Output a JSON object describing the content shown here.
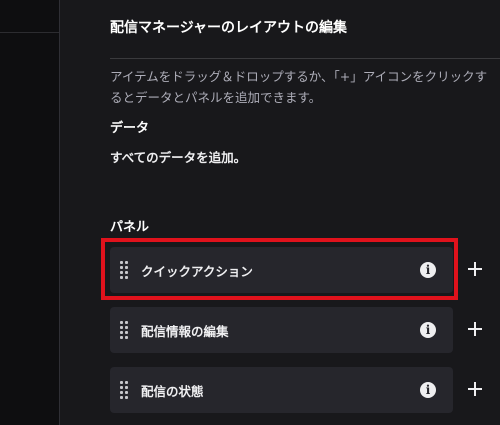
{
  "panel": {
    "title": "配信マネージャーのレイアウトの編集",
    "description": "アイテムをドラッグ＆ドロップするか、「+」アイコンをクリックするとデータとパネルを追加できます。",
    "data_section": {
      "heading": "データ",
      "add_all_label": "すべてのデータを追加。"
    },
    "panel_section": {
      "heading": "パネル",
      "items": [
        {
          "label": "クイックアクション",
          "info_icon": "info-icon",
          "add_icon": "plus-icon",
          "highlighted": true
        },
        {
          "label": "配信情報の編集",
          "info_icon": "info-icon",
          "add_icon": "plus-icon",
          "highlighted": false
        },
        {
          "label": "配信の状態",
          "info_icon": "info-icon",
          "add_icon": "plus-icon",
          "highlighted": false
        }
      ]
    }
  },
  "colors": {
    "background": "#18181b",
    "card": "#26262c",
    "highlight_border": "#e0121c",
    "text_primary": "#efeff1",
    "text_secondary": "#adadb8"
  }
}
